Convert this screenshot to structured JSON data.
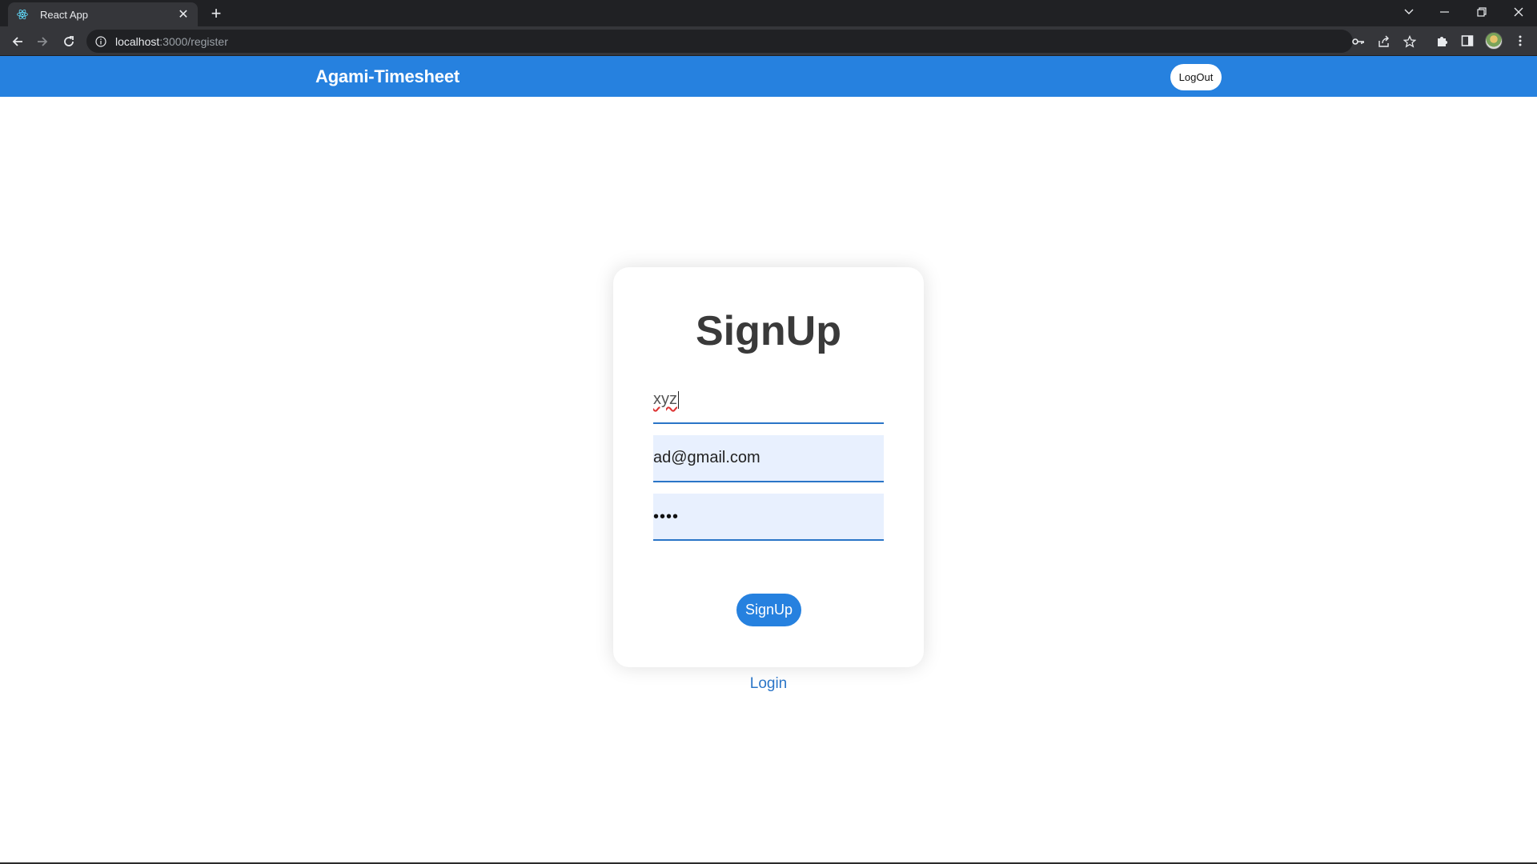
{
  "browser": {
    "tab_title": "React App",
    "url_host": "localhost",
    "url_path": ":3000/register",
    "icons": [
      "react-favicon",
      "close-icon",
      "plus-icon",
      "chevron-down-icon",
      "minimize-icon",
      "restore-icon",
      "window-close-icon",
      "back-arrow-icon",
      "forward-arrow-icon",
      "reload-icon",
      "info-icon",
      "key-icon",
      "share-icon",
      "star-icon",
      "extensions-icon",
      "side-panel-icon",
      "profile-avatar",
      "more-vert-icon"
    ]
  },
  "appbar": {
    "brand": "Agami-Timesheet",
    "logout_label": "LogOut",
    "color": "#2681df"
  },
  "form": {
    "title": "SignUp",
    "name_value": "xyz",
    "email_value": "ad@gmail.com",
    "password_mask": "••••",
    "submit_label": "SignUp"
  },
  "footer": {
    "login_link": "Login"
  }
}
